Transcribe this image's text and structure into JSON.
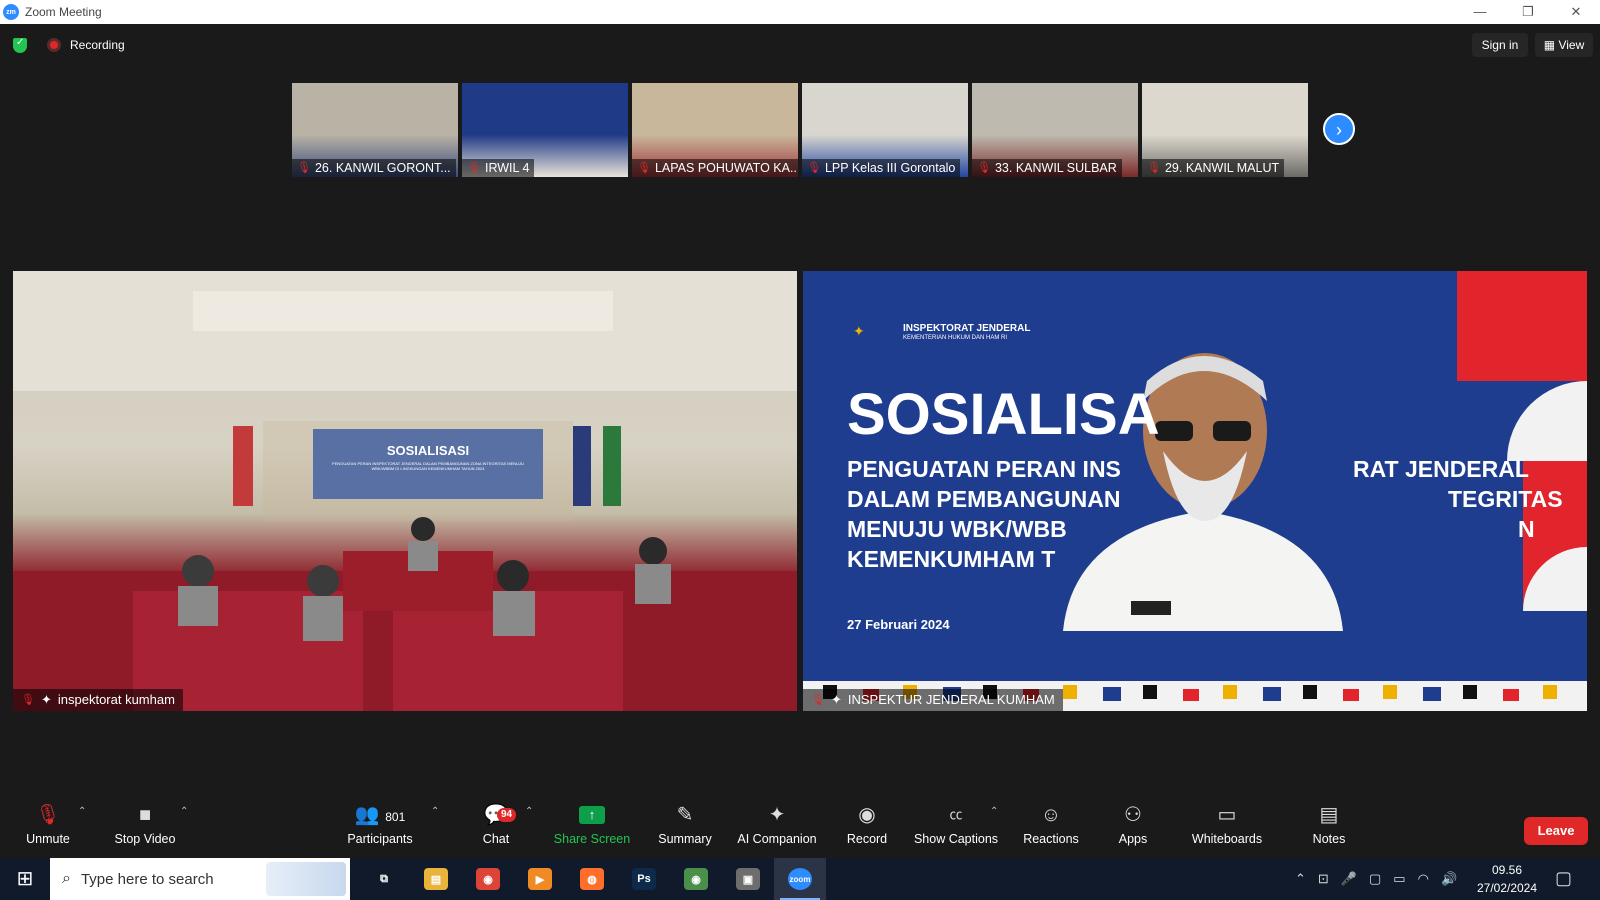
{
  "window": {
    "title": "Zoom Meeting",
    "logo_text": "zm",
    "controls": [
      "—",
      "❐",
      "✕"
    ]
  },
  "meeting_bar": {
    "recording_label": "Recording",
    "sign_in_label": "Sign in",
    "view_label": "View",
    "view_icon": "▦"
  },
  "thumbnails": [
    {
      "label": "26. KANWIL GORONT...",
      "bg": "#b9b3a6",
      "accent": "#3a4b7a"
    },
    {
      "label": "IRWIL 4",
      "bg": "#1f3a86",
      "accent": "#e8e3da"
    },
    {
      "label": "LAPAS POHUWATO KA...",
      "bg": "#c9b79c",
      "accent": "#a0343a"
    },
    {
      "label": "LPP Kelas III Gorontalo",
      "bg": "#d9d6cf",
      "accent": "#2246a0"
    },
    {
      "label": "33. KANWIL SULBAR",
      "bg": "#bfbab0",
      "accent": "#7a2a2a"
    },
    {
      "label": "29. KANWIL MALUT",
      "bg": "#ddd8ce",
      "accent": "#6c6a66"
    }
  ],
  "tiles": {
    "left": {
      "name": "inspektorat kumham",
      "screen_title": "SOSIALISASI",
      "screen_subtitle": "PENGUATAN PERAN INSPEKTORAT JENDERAL DALAM PEMBANGUNAN ZONA INTEGRITAS MENUJU WBK/WBBM DI LINGKUNGAN KEMENKUMHAM TAHUN 2024"
    },
    "right": {
      "name": "INSPEKTUR JENDERAL KUMHAM",
      "org_title": "INSPEKTORAT JENDERAL",
      "org_subtitle": "KEMENTERIAN HUKUM DAN HAM RI",
      "heading": "SOSIALISA",
      "line1": "PENGUATAN PERAN INS",
      "line1b": "RAT JENDERAL",
      "line2": "DALAM PEMBANGUNAN",
      "line2b": "TEGRITAS",
      "line3": "MENUJU WBK/WBB",
      "line3b": "N",
      "line4": "KEMENKUMHAM T",
      "date": "27 Februari 2024"
    }
  },
  "toolbar": {
    "unmute": "Unmute",
    "stop_video": "Stop Video",
    "participants": "Participants",
    "participants_count": "801",
    "chat": "Chat",
    "chat_badge": "94",
    "share_screen": "Share Screen",
    "summary": "Summary",
    "ai_companion": "AI Companion",
    "record": "Record",
    "show_captions": "Show Captions",
    "reactions": "Reactions",
    "apps": "Apps",
    "whiteboards": "Whiteboards",
    "notes": "Notes",
    "leave": "Leave"
  },
  "taskbar": {
    "search_placeholder": "Type here to search",
    "apps": [
      {
        "name": "task-view",
        "glyph": "⧉",
        "color": "transparent"
      },
      {
        "name": "file-explorer",
        "glyph": "▤",
        "color": "#e8b43a"
      },
      {
        "name": "chrome",
        "glyph": "◉",
        "color": "#db4437"
      },
      {
        "name": "media-player",
        "glyph": "▶",
        "color": "#f08a24"
      },
      {
        "name": "firefox",
        "glyph": "◍",
        "color": "#ff6f2b"
      },
      {
        "name": "photoshop",
        "glyph": "Ps",
        "color": "#0d2a4a"
      },
      {
        "name": "chrome-profile",
        "glyph": "◉",
        "color": "#4a8f4a"
      },
      {
        "name": "windows-store",
        "glyph": "▣",
        "color": "#6d6d6d"
      },
      {
        "name": "zoom",
        "glyph": "zoom",
        "color": "#2d8cff"
      }
    ],
    "tray_icons": [
      "⌃",
      "⊡",
      "🎤",
      "▢",
      "▭",
      "◠",
      "🔊"
    ],
    "time": "09.56",
    "date": "27/02/2024"
  }
}
